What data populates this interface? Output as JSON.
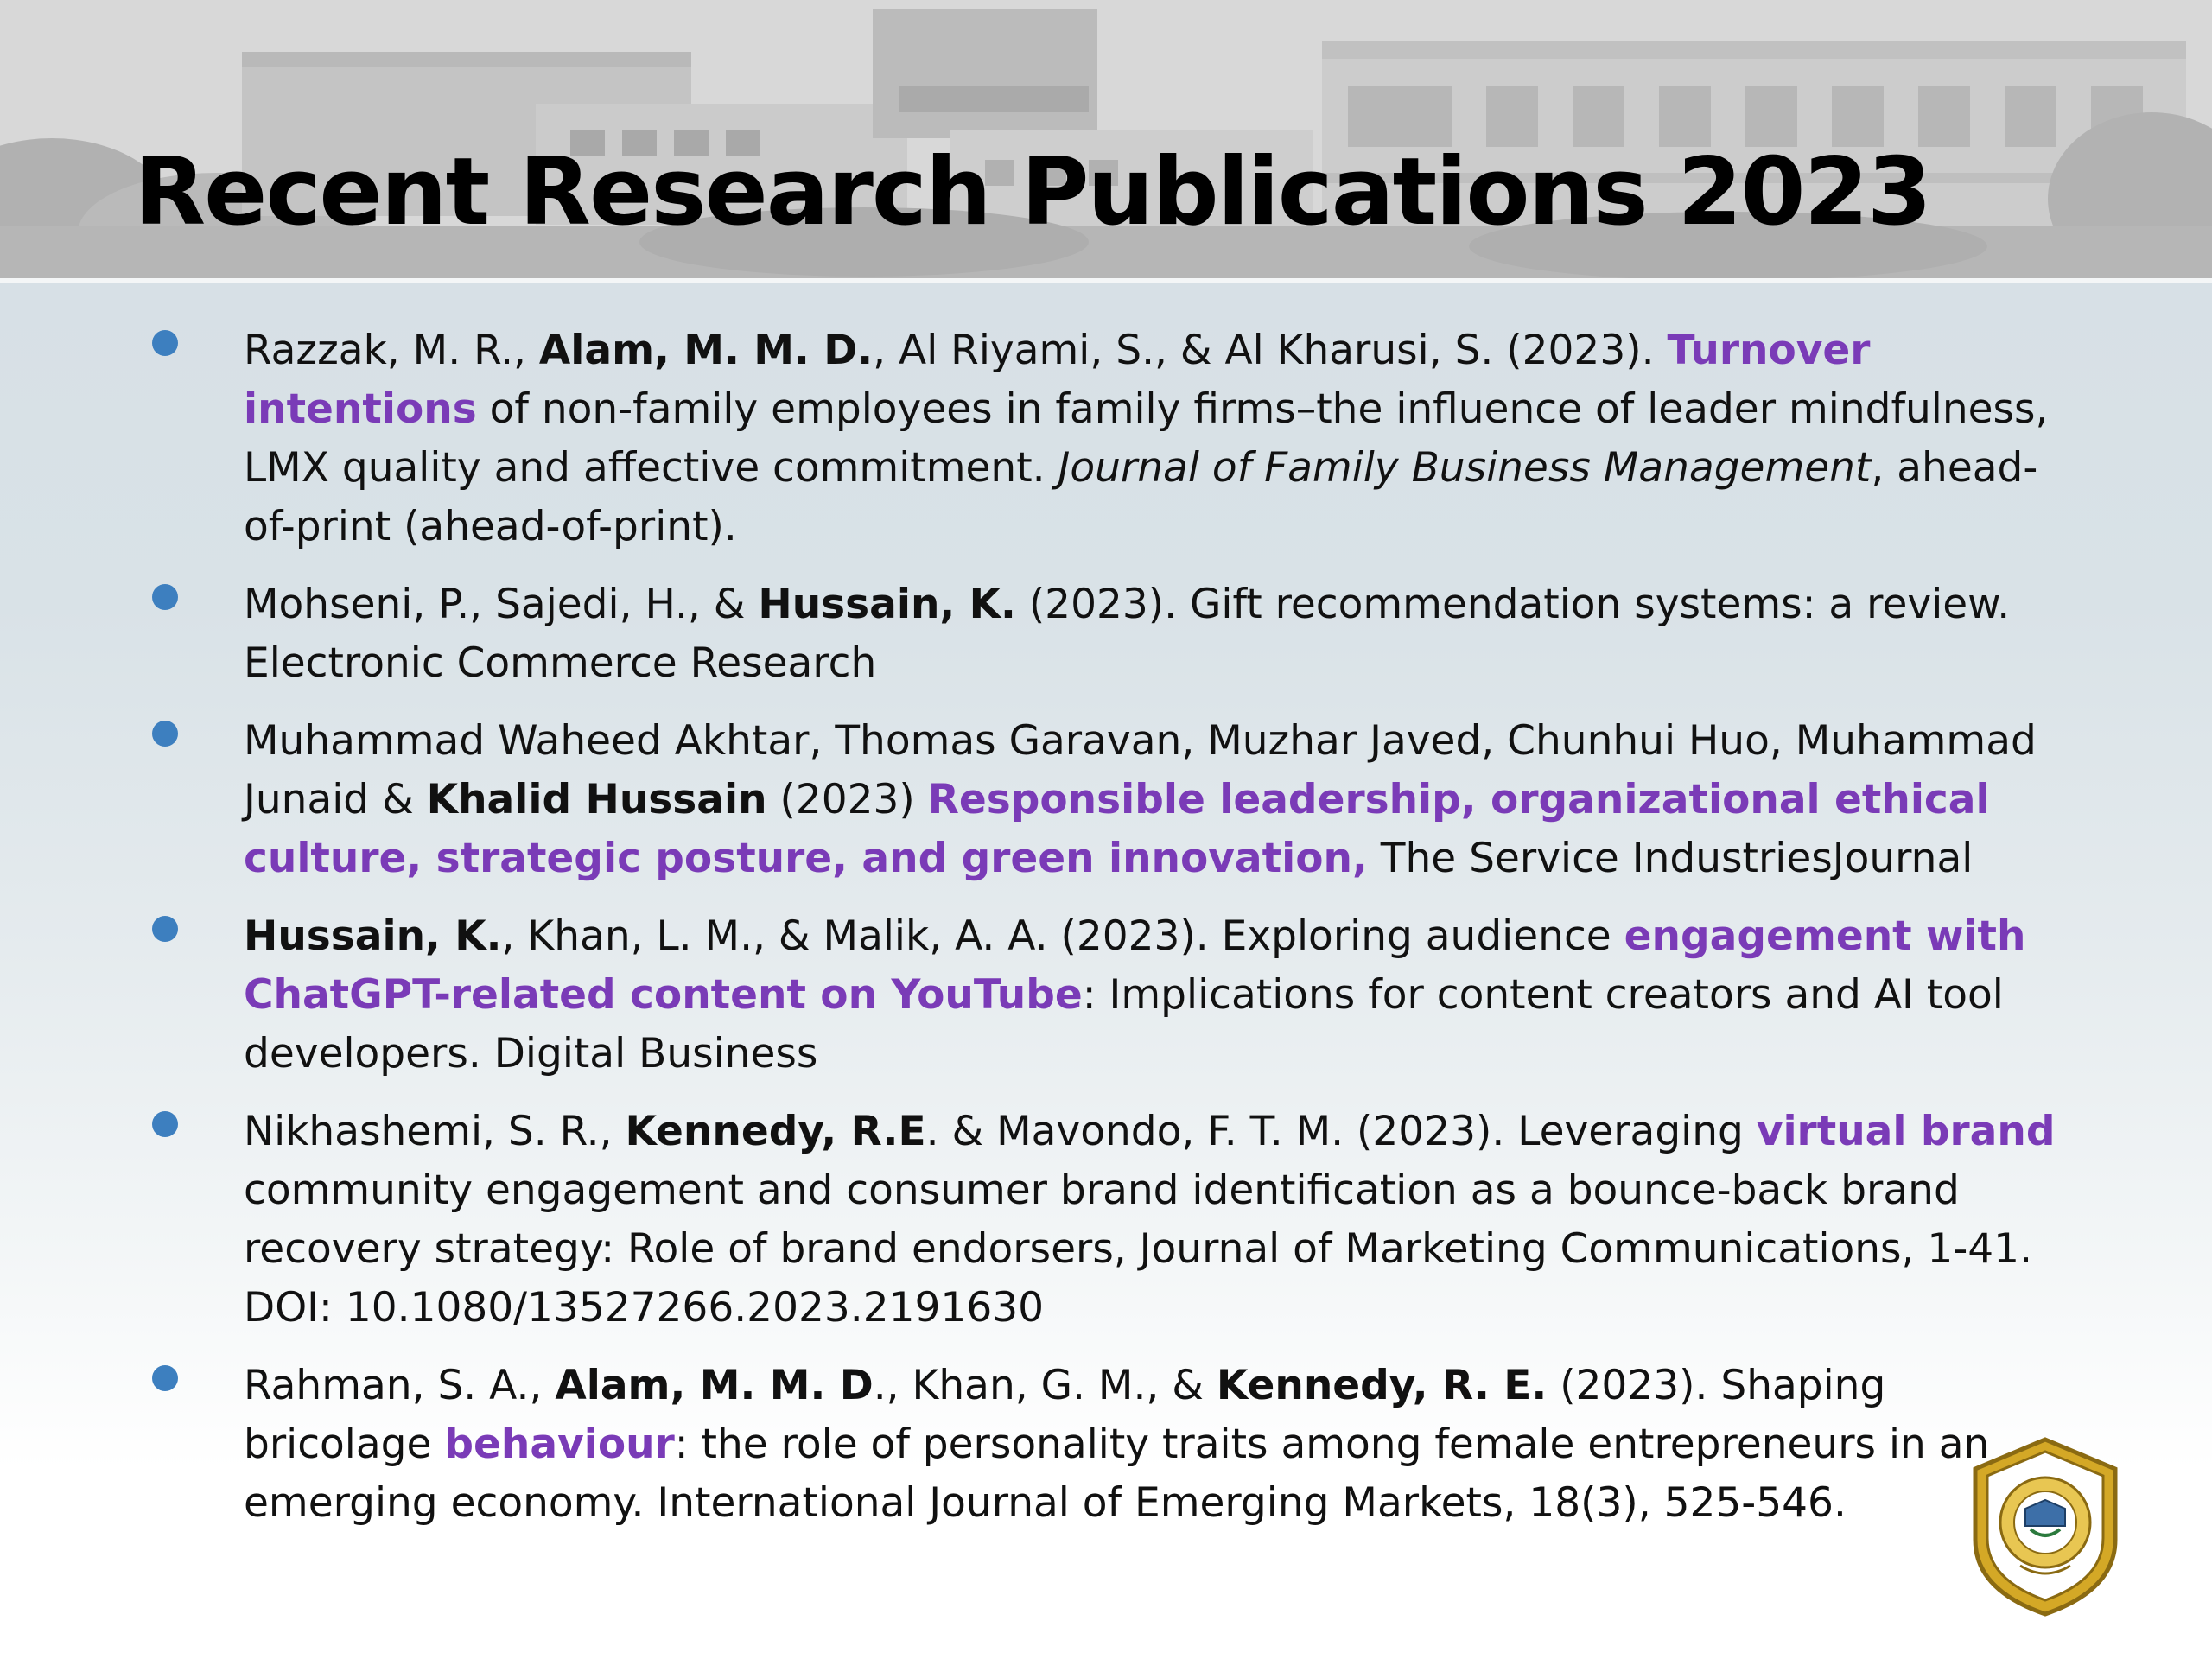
{
  "slide": {
    "title": "Recent Research Publications 2023"
  },
  "publications": [
    {
      "segments": [
        {
          "text": "Razzak, M. R., ",
          "style": "normal"
        },
        {
          "text": "Alam, M. M. D.",
          "style": "bold"
        },
        {
          "text": ", Al Riyami, S., & Al Kharusi, S. (2023). ",
          "style": "normal"
        },
        {
          "text": "Turnover intentions",
          "style": "highlight"
        },
        {
          "text": " of non-family employees in family firms–the influence of leader mindfulness, LMX quality and affective commitment. ",
          "style": "normal"
        },
        {
          "text": "Journal of Family Business Management",
          "style": "italic"
        },
        {
          "text": ", ahead-of-print (ahead-of-print).",
          "style": "normal"
        }
      ]
    },
    {
      "segments": [
        {
          "text": "Mohseni, P., Sajedi, H., & ",
          "style": "normal"
        },
        {
          "text": "Hussain, K.",
          "style": "bold"
        },
        {
          "text": " (2023). Gift recommendation systems: a review. Electronic Commerce Research",
          "style": "normal"
        }
      ]
    },
    {
      "segments": [
        {
          "text": "Muhammad Waheed Akhtar, Thomas Garavan, Muzhar Javed, Chunhui Huo, Muhammad Junaid &  ",
          "style": "normal"
        },
        {
          "text": "Khalid Hussain",
          "style": "bold"
        },
        {
          "text": " (2023) ",
          "style": "normal"
        },
        {
          "text": "Responsible leadership, organizational ethical culture, strategic posture, and green innovation,",
          "style": "highlight"
        },
        {
          "text": " The Service IndustriesJournal",
          "style": "normal"
        }
      ]
    },
    {
      "segments": [
        {
          "text": "Hussain, K.",
          "style": "bold"
        },
        {
          "text": ", Khan, L. M., & Malik, A. A. (2023). Exploring audience ",
          "style": "normal"
        },
        {
          "text": "engagement with ChatGPT-related content on YouTube",
          "style": "highlight"
        },
        {
          "text": ": Implications for content creators and AI tool developers. Digital Business",
          "style": "normal"
        }
      ]
    },
    {
      "segments": [
        {
          "text": "Nikhashemi, S. R., ",
          "style": "normal"
        },
        {
          "text": "Kennedy, R.E",
          "style": "bold"
        },
        {
          "text": ". & Mavondo, F. T. M. (2023). Leveraging ",
          "style": "normal"
        },
        {
          "text": "virtual brand",
          "style": "highlight"
        },
        {
          "text": " community engagement and consumer brand identification as a bounce-back brand recovery strategy: Role of brand endorsers, Journal of Marketing Communications, 1-41. DOI: 10.1080/13527266.2023.2191630",
          "style": "normal"
        }
      ]
    },
    {
      "segments": [
        {
          "text": "Rahman, S. A., ",
          "style": "normal"
        },
        {
          "text": "Alam, M. M. D",
          "style": "bold"
        },
        {
          "text": "., Khan, G. M., & ",
          "style": "normal"
        },
        {
          "text": "Kennedy, R. E.",
          "style": "bold"
        },
        {
          "text": " (2023). Shaping bricolage ",
          "style": "normal"
        },
        {
          "text": "behaviour",
          "style": "highlight"
        },
        {
          "text": ": the role of personality traits among female entrepreneurs in an emerging economy. International Journal of Emerging Markets, 18(3), 525-546.",
          "style": "normal"
        }
      ]
    }
  ],
  "colors": {
    "highlight": "#7a3bb7",
    "bullet": "#3d7fbf",
    "text": "#111111",
    "title": "#000000",
    "seal_gold": "#d4a826"
  },
  "icons": {
    "bullet": "bullet-dot-icon",
    "seal": "university-seal-icon"
  }
}
